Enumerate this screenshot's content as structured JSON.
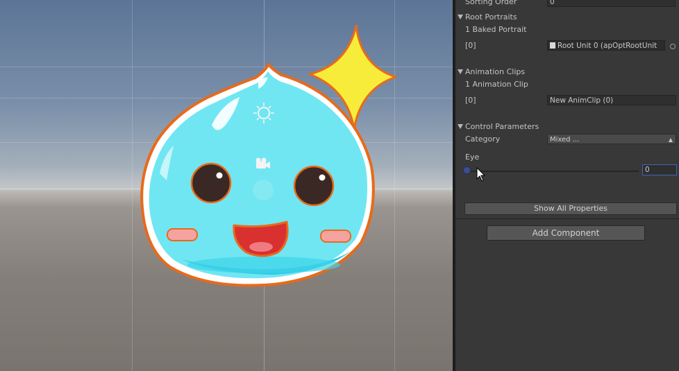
{
  "inspector": {
    "sorting_order": {
      "label": "Sorting Order",
      "value": "0"
    },
    "root_portraits": {
      "header": "Root Portraits",
      "count_label": "1 Baked Portrait",
      "items": [
        {
          "index": "[0]",
          "value": "Root Unit 0 (apOptRootUnit"
        }
      ]
    },
    "animation_clips": {
      "header": "Animation Clips",
      "count_label": "1 Animation Clip",
      "items": [
        {
          "index": "[0]",
          "value": "New AnimClip (0)"
        }
      ]
    },
    "control_parameters": {
      "header": "Control Parameters",
      "category_label": "Category",
      "category_value": "Mixed ...",
      "param_label": "Eye",
      "param_value": "0",
      "param_level": 0
    },
    "show_all_properties": "Show All Properties",
    "add_component": "Add Component"
  },
  "colors": {
    "slime_body": "#70e6f2",
    "outline": "#e86a1a",
    "star": "#f8ec3a",
    "mouth": "#d93030",
    "inspector_bg": "#383838",
    "slider_knob": "#3b4f8c"
  }
}
